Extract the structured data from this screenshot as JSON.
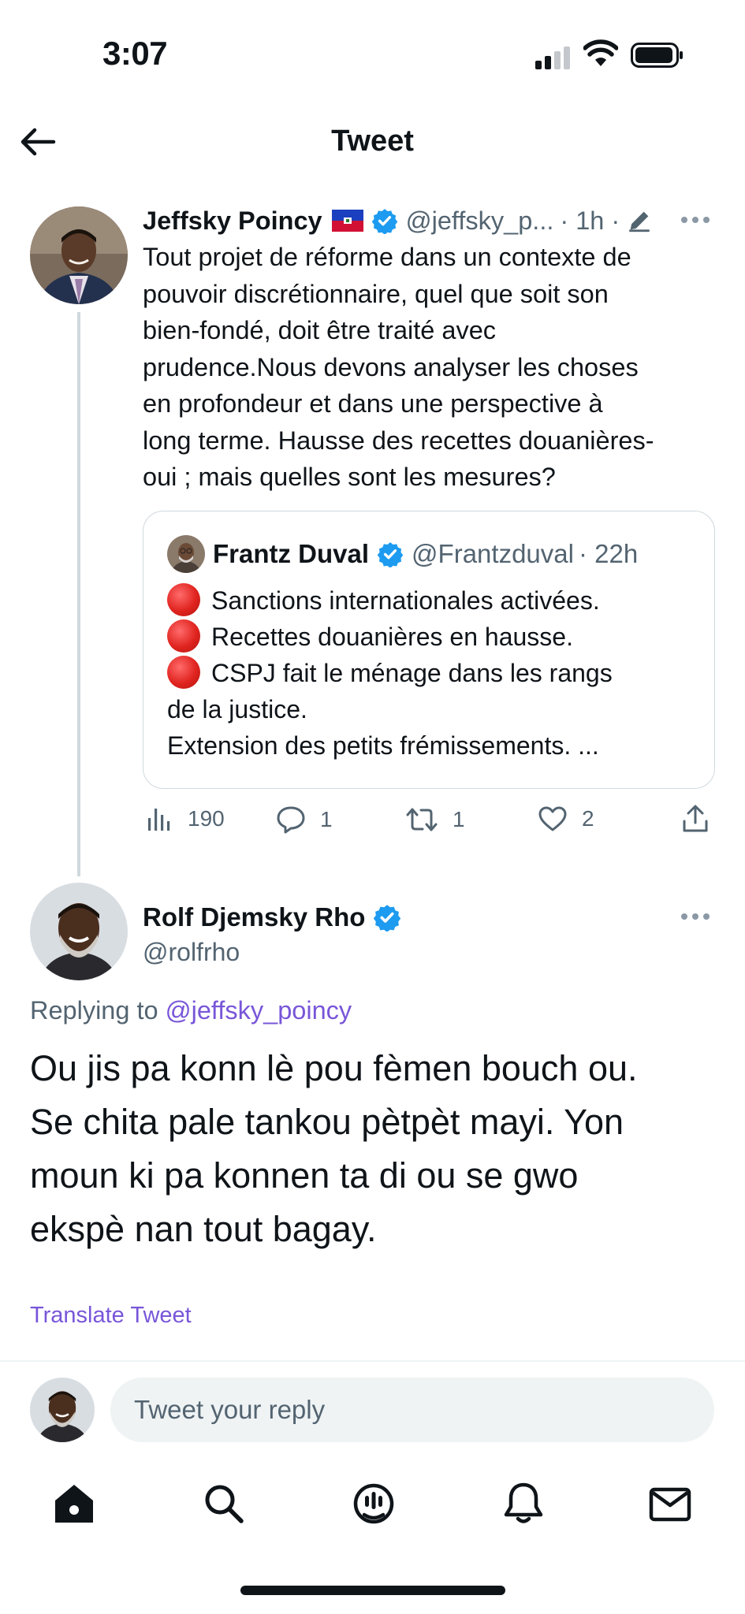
{
  "status_bar": {
    "time": "3:07"
  },
  "header": {
    "title": "Tweet"
  },
  "main_tweet": {
    "author_name": "Jeffsky Poincy",
    "handle": "@jeffsky_p...",
    "time": "· 1h ·",
    "text_lines": [
      "Tout projet de réforme dans un contexte de",
      "pouvoir discrétionnaire, quel que soit son",
      "bien-fondé, doit être traité avec",
      "prudence.Nous devons analyser les choses",
      "en profondeur et dans une perspective à",
      "long terme. Hausse des recettes douanières-",
      "oui ; mais quelles sont les mesures?"
    ],
    "quote": {
      "author_name": "Frantz Duval",
      "handle": "@Frantzduval",
      "time": "· 22h",
      "lines": [
        "Sanctions internationales activées.",
        "Recettes douanières en hausse.",
        "CSPJ fait le ménage dans les rangs",
        "de la justice.",
        "Extension des petits frémissements. ..."
      ]
    },
    "actions": {
      "views": "190",
      "replies": "1",
      "retweets": "1",
      "likes": "2"
    }
  },
  "reply_tweet": {
    "author_name": "Rolf Djemsky Rho",
    "handle": "@rolfrho",
    "replying_prefix": "Replying to",
    "replying_handle": "@jeffsky_poincy",
    "text_lines": [
      "Ou jis pa konn lè pou fèmen bouch ou.",
      "Se chita pale tankou pètpèt mayi. Yon",
      "moun ki pa konnen ta di ou se gwo",
      "ekspè nan tout bagay."
    ],
    "translate_label": "Translate Tweet"
  },
  "reply_input": {
    "placeholder": "Tweet your reply"
  },
  "bottom_tabs": [
    "home-icon",
    "search-icon",
    "spaces-icon",
    "notifications-icon",
    "messages-icon"
  ],
  "colors": {
    "verified": "#1d9bf0",
    "link": "#7856d9",
    "muted": "#536471",
    "text": "#0f1419"
  }
}
